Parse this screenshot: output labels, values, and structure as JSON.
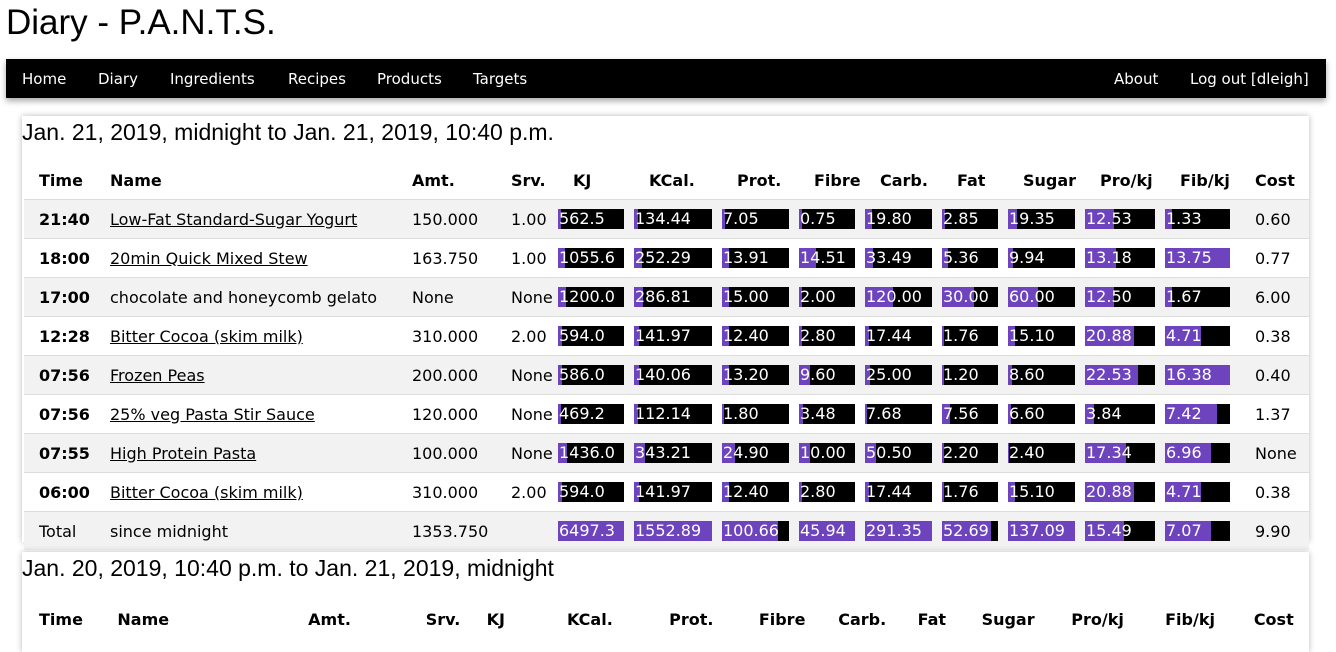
{
  "site_title": "Diary - P.A.N.T.S.",
  "nav": {
    "left": [
      "Home",
      "Diary",
      "Ingredients",
      "Recipes",
      "Products",
      "Targets"
    ],
    "about": "About",
    "logout": "Log out [dleigh]"
  },
  "columns": [
    "Time",
    "Name",
    "Amt.",
    "Srv.",
    "KJ",
    "KCal.",
    "Prot.",
    "Fibre",
    "Carb.",
    "Fat",
    "Sugar",
    "Pro/kj",
    "Fib/kj",
    "Cost"
  ],
  "colors": {
    "bar_fill": "#6d44bd",
    "bar_bg": "#000000",
    "nav_bg": "#000000"
  },
  "sections": [
    {
      "title": "Jan. 21, 2019, midnight to Jan. 21, 2019, 10:40 p.m.",
      "rows": [
        {
          "time": "21:40",
          "name": "Low-Fat Standard-Sugar Yogurt",
          "link": true,
          "amt": "150.000",
          "srv": "1.00",
          "bars": [
            [
              "562.5",
              0.05
            ],
            [
              "134.44",
              0.05
            ],
            [
              "7.05",
              0.05
            ],
            [
              "0.75",
              0.05
            ],
            [
              "19.80",
              0.1
            ],
            [
              "2.85",
              0.05
            ],
            [
              "19.35",
              0.14
            ],
            [
              "12.53",
              0.42
            ],
            [
              "1.33",
              0.1
            ]
          ],
          "cost": "0.60"
        },
        {
          "time": "18:00",
          "name": "20min Quick Mixed Stew",
          "link": true,
          "amt": "163.750",
          "srv": "1.00",
          "bars": [
            [
              "1055.6",
              0.1
            ],
            [
              "252.29",
              0.1
            ],
            [
              "13.91",
              0.1
            ],
            [
              "14.51",
              0.3
            ],
            [
              "33.49",
              0.12
            ],
            [
              "5.36",
              0.1
            ],
            [
              "9.94",
              0.07
            ],
            [
              "13.18",
              0.44
            ],
            [
              "13.75",
              1.0
            ]
          ],
          "cost": "0.77"
        },
        {
          "time": "17:00",
          "name": "chocolate and honeycomb gelato",
          "link": false,
          "amt": "None",
          "srv": "None",
          "bars": [
            [
              "1200.0",
              0.12
            ],
            [
              "286.81",
              0.12
            ],
            [
              "15.00",
              0.1
            ],
            [
              "2.00",
              0.05
            ],
            [
              "120.00",
              0.42
            ],
            [
              "30.00",
              0.58
            ],
            [
              "60.00",
              0.45
            ],
            [
              "12.50",
              0.42
            ],
            [
              "1.67",
              0.1
            ]
          ],
          "cost": "6.00"
        },
        {
          "time": "12:28",
          "name": "Bitter Cocoa (skim milk)",
          "link": true,
          "amt": "310.000",
          "srv": "2.00",
          "bars": [
            [
              "594.0",
              0.06
            ],
            [
              "141.97",
              0.06
            ],
            [
              "12.40",
              0.1
            ],
            [
              "2.80",
              0.06
            ],
            [
              "17.44",
              0.06
            ],
            [
              "1.76",
              0.03
            ],
            [
              "15.10",
              0.11
            ],
            [
              "20.88",
              0.7
            ],
            [
              "4.71",
              0.55
            ]
          ],
          "cost": "0.38"
        },
        {
          "time": "07:56",
          "name": "Frozen Peas",
          "link": true,
          "amt": "200.000",
          "srv": "None",
          "bars": [
            [
              "586.0",
              0.06
            ],
            [
              "140.06",
              0.06
            ],
            [
              "13.20",
              0.1
            ],
            [
              "9.60",
              0.2
            ],
            [
              "25.00",
              0.08
            ],
            [
              "1.20",
              0.03
            ],
            [
              "8.60",
              0.06
            ],
            [
              "22.53",
              0.75
            ],
            [
              "16.38",
              1.0
            ]
          ],
          "cost": "0.40"
        },
        {
          "time": "07:56",
          "name": "25% veg Pasta Stir Sauce",
          "link": true,
          "amt": "120.000",
          "srv": "None",
          "bars": [
            [
              "469.2",
              0.05
            ],
            [
              "112.14",
              0.05
            ],
            [
              "1.80",
              0.03
            ],
            [
              "3.48",
              0.07
            ],
            [
              "7.68",
              0.03
            ],
            [
              "7.56",
              0.15
            ],
            [
              "6.60",
              0.05
            ],
            [
              "3.84",
              0.13
            ],
            [
              "7.42",
              0.8
            ]
          ],
          "cost": "1.37"
        },
        {
          "time": "07:55",
          "name": "High Protein Pasta",
          "link": true,
          "amt": "100.000",
          "srv": "None",
          "bars": [
            [
              "1436.0",
              0.14
            ],
            [
              "343.21",
              0.14
            ],
            [
              "24.90",
              0.2
            ],
            [
              "10.00",
              0.2
            ],
            [
              "50.50",
              0.17
            ],
            [
              "2.20",
              0.04
            ],
            [
              "2.40",
              0.02
            ],
            [
              "17.34",
              0.58
            ],
            [
              "6.96",
              0.7
            ]
          ],
          "cost": "None"
        },
        {
          "time": "06:00",
          "name": "Bitter Cocoa (skim milk)",
          "link": true,
          "amt": "310.000",
          "srv": "2.00",
          "bars": [
            [
              "594.0",
              0.06
            ],
            [
              "141.97",
              0.06
            ],
            [
              "12.40",
              0.1
            ],
            [
              "2.80",
              0.06
            ],
            [
              "17.44",
              0.06
            ],
            [
              "1.76",
              0.03
            ],
            [
              "15.10",
              0.11
            ],
            [
              "20.88",
              0.7
            ],
            [
              "4.71",
              0.55
            ]
          ],
          "cost": "0.38"
        },
        {
          "time": "Total",
          "name": "since midnight",
          "link": false,
          "total": true,
          "amt": "1353.750",
          "srv": "",
          "bars": [
            [
              "6497.3",
              1.0
            ],
            [
              "1552.89",
              1.0
            ],
            [
              "100.66",
              0.84
            ],
            [
              "45.94",
              1.0
            ],
            [
              "291.35",
              1.0
            ],
            [
              "52.69",
              0.88
            ],
            [
              "137.09",
              1.0
            ],
            [
              "15.49",
              0.55
            ],
            [
              "7.07",
              0.7
            ]
          ],
          "cost": "9.90"
        }
      ]
    },
    {
      "title": "Jan. 20, 2019, 10:40 p.m. to Jan. 21, 2019, midnight",
      "rows": []
    }
  ]
}
